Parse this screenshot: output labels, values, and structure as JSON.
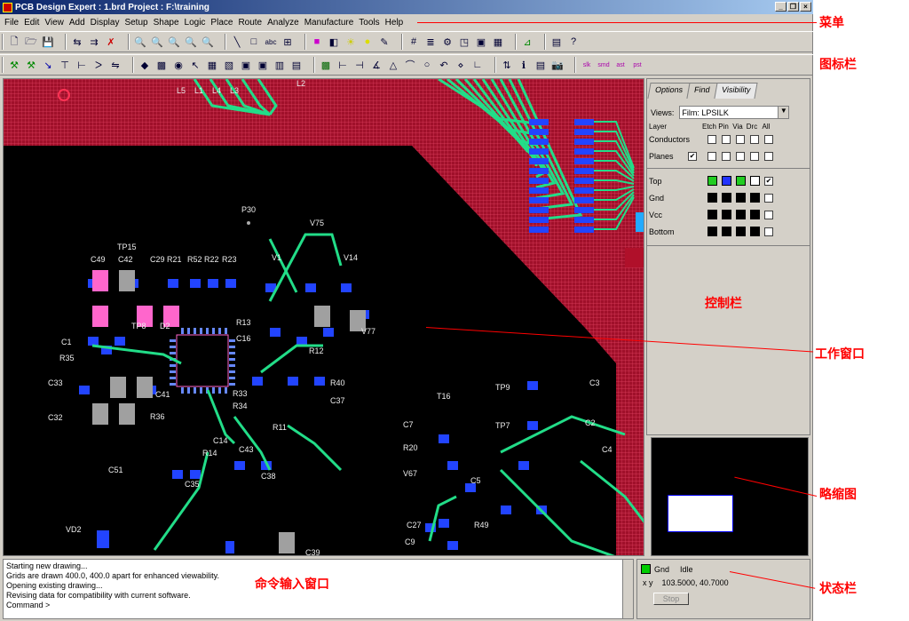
{
  "window": {
    "title": "PCB Design Expert : 1.brd   Project : F:\\training"
  },
  "menu": [
    "File",
    "Edit",
    "View",
    "Add",
    "Display",
    "Setup",
    "Shape",
    "Logic",
    "Place",
    "Route",
    "Analyze",
    "Manufacture",
    "Tools",
    "Help"
  ],
  "control_panel": {
    "tabs": [
      "Options",
      "Find",
      "Visibility"
    ],
    "views_label": "Views:",
    "views_value": "Film: LPSILK",
    "layer_header": "Layer",
    "col_headers": [
      "Etch",
      "Pin",
      "Via",
      "Drc",
      "All"
    ],
    "conductors_label": "Conductors",
    "planes_label": "Planes",
    "layers": [
      {
        "name": "Top",
        "colors": [
          "#22cc22",
          "#2233ff",
          "#22cc22",
          "#ffffff"
        ]
      },
      {
        "name": "Gnd",
        "colors": [
          "#000000",
          "#000000",
          "#000000",
          "#000000"
        ]
      },
      {
        "name": "Vcc",
        "colors": [
          "#000000",
          "#000000",
          "#000000",
          "#000000"
        ]
      },
      {
        "name": "Bottom",
        "colors": [
          "#000000",
          "#000000",
          "#000000",
          "#000000"
        ]
      }
    ],
    "label_cn": "控制栏"
  },
  "command_window": {
    "lines": [
      "Starting new drawing...",
      "Grids are drawn 400.0, 400.0 apart for enhanced viewability.",
      "Opening existing drawing...",
      "Revising data for compatibility with current software.",
      "Command >"
    ],
    "label_cn": "命令输入窗口"
  },
  "status": {
    "layer": "Gnd",
    "state": "Idle",
    "xy_label": "x y",
    "coords": "103.5000, 40.7000",
    "stop": "Stop"
  },
  "pcb_labels": [
    "P30",
    "V75",
    "V1",
    "V14",
    "TP15",
    "C49",
    "C42",
    "C29",
    "R21",
    "R52",
    "R22",
    "R23",
    "R13",
    "C16",
    "V77",
    "R35",
    "C1",
    "C33",
    "TP8",
    "D2",
    "C32",
    "R36",
    "C51",
    "R40",
    "C37",
    "R12",
    "R34",
    "R33",
    "C41",
    "C14",
    "R14",
    "C43",
    "C35",
    "C38",
    "R11",
    "T16",
    "C7",
    "R20",
    "V67",
    "C5",
    "C27",
    "C9",
    "C3",
    "R49",
    "TP9",
    "TP7",
    "C2",
    "C4",
    "VD2",
    "C39",
    "L1",
    "L5",
    "L4",
    "L3",
    "L2",
    "L8"
  ],
  "annotations": [
    "菜单",
    "图标栏",
    "工作窗口",
    "略缩图",
    "状态栏"
  ]
}
